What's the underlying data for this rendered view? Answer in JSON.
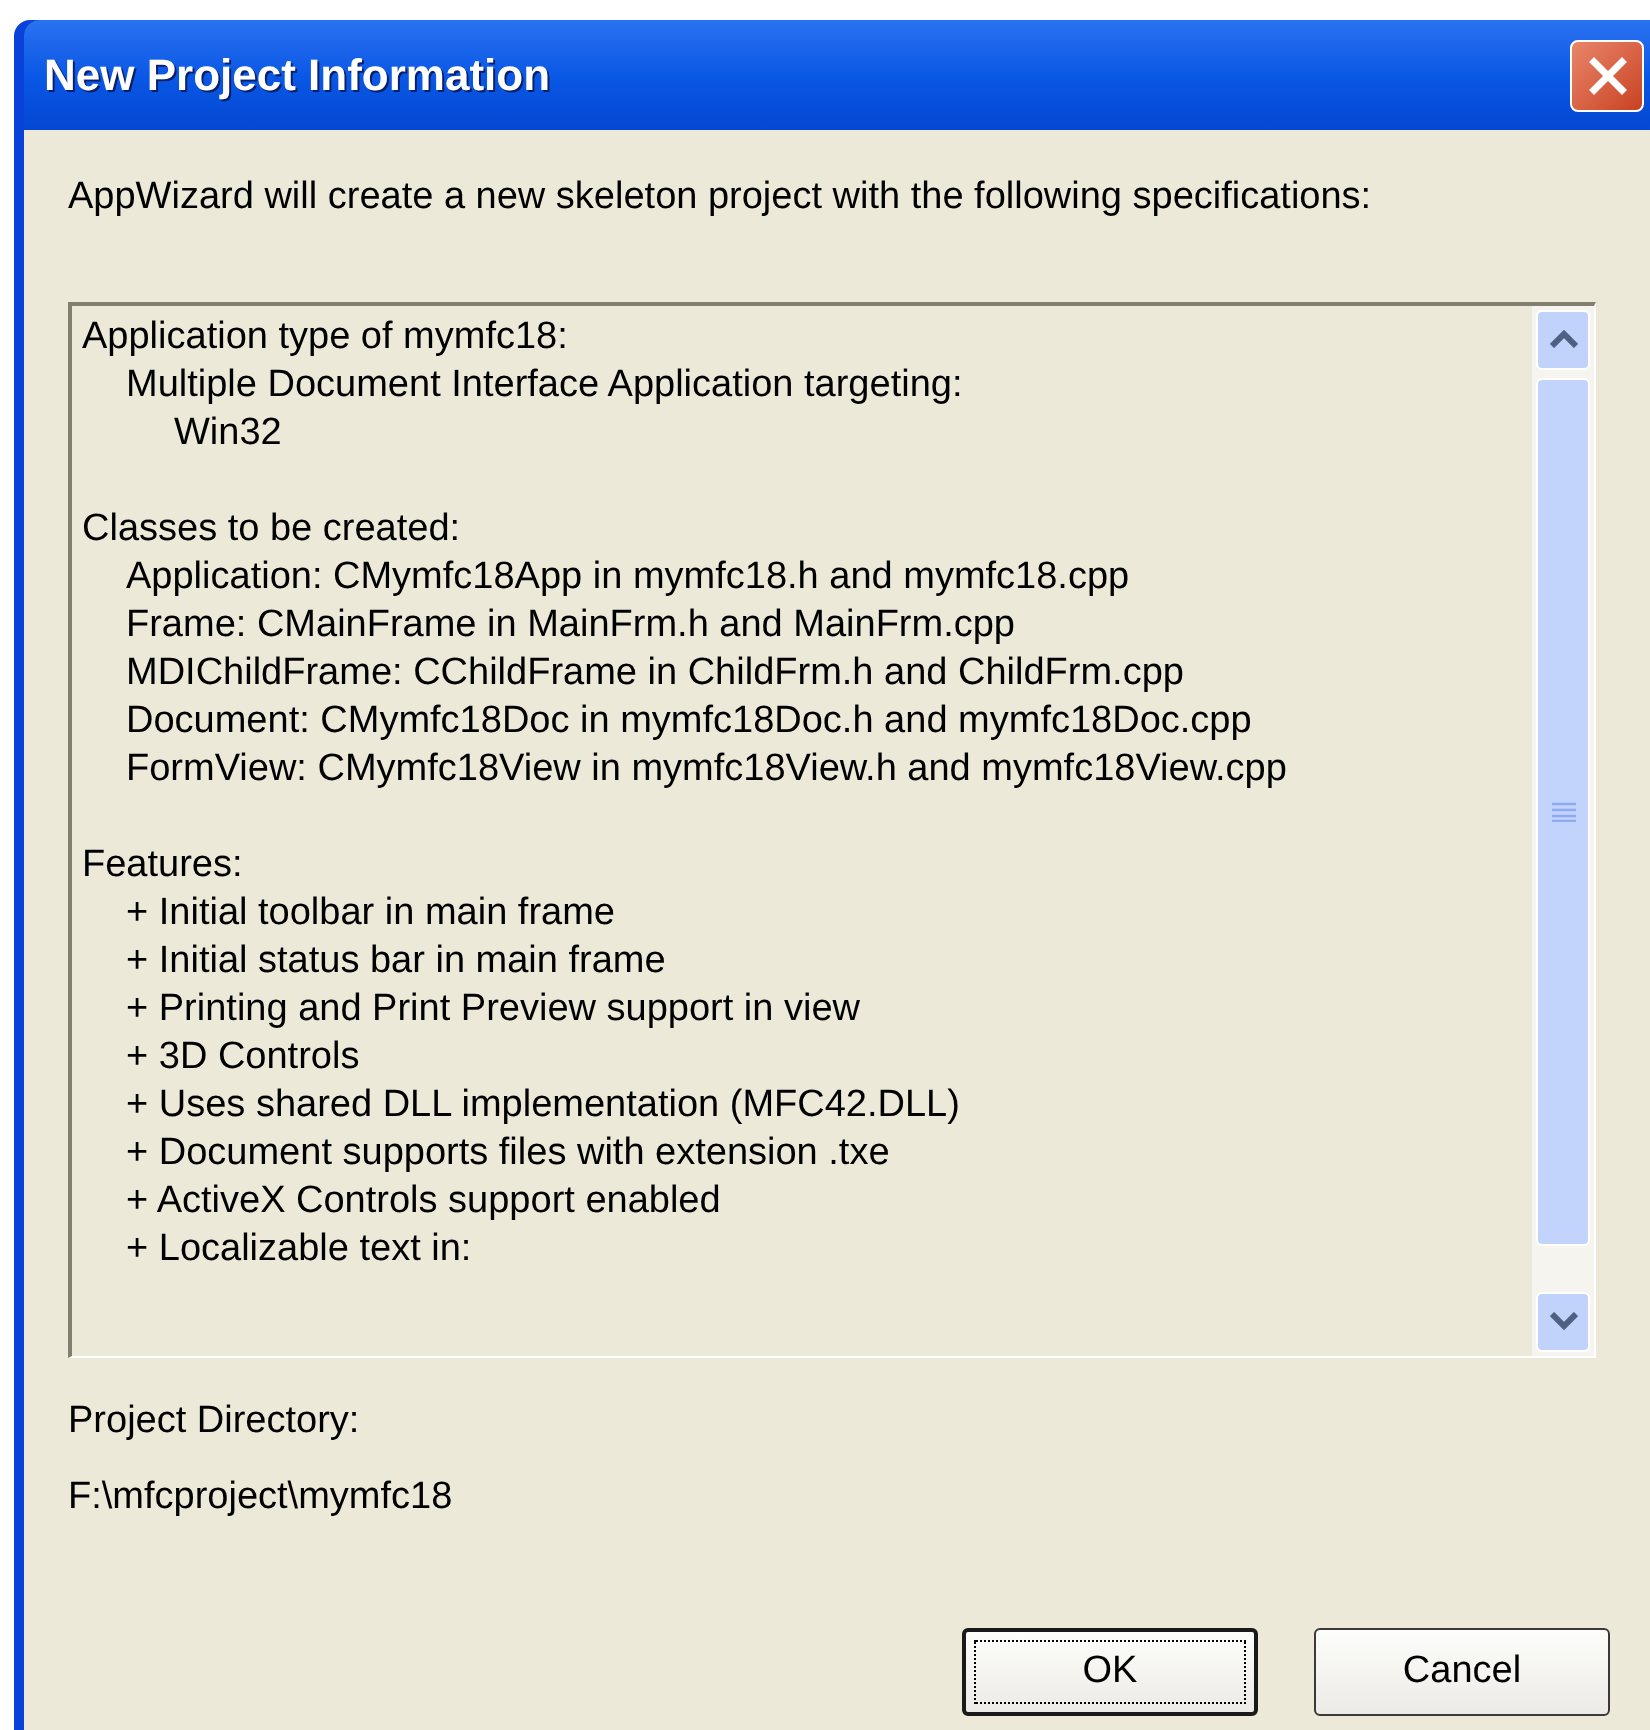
{
  "window": {
    "title": "New Project Information"
  },
  "intro": "AppWizard will create a new skeleton project with the following specifications:",
  "specifications": [
    {
      "text": "Application type of mymfc18:",
      "children": [
        {
          "text": "Multiple Document Interface Application targeting:",
          "children": [
            {
              "text": "Win32"
            }
          ]
        }
      ]
    },
    {
      "text": "Classes to be created:",
      "children": [
        {
          "text": "Application: CMymfc18App in mymfc18.h and mymfc18.cpp"
        },
        {
          "text": "Frame: CMainFrame in MainFrm.h and MainFrm.cpp"
        },
        {
          "text": "MDIChildFrame: CChildFrame in ChildFrm.h and ChildFrm.cpp"
        },
        {
          "text": "Document: CMymfc18Doc in mymfc18Doc.h and mymfc18Doc.cpp"
        },
        {
          "text": "FormView: CMymfc18View in mymfc18View.h and mymfc18View.cpp"
        }
      ]
    },
    {
      "text": "Features:",
      "children": [
        {
          "text": "+ Initial toolbar in main frame"
        },
        {
          "text": "+ Initial status bar in main frame"
        },
        {
          "text": "+ Printing and Print Preview support in view"
        },
        {
          "text": "+ 3D Controls"
        },
        {
          "text": "+ Uses shared DLL implementation (MFC42.DLL)"
        },
        {
          "text": "+ Document supports files with extension .txe"
        },
        {
          "text": "+ ActiveX Controls support enabled"
        },
        {
          "text": "+ Localizable text in:"
        }
      ]
    }
  ],
  "project_directory": {
    "label": "Project Directory:",
    "value": "F:\\mfcproject\\mymfc18"
  },
  "buttons": [
    {
      "label": "OK",
      "default": true
    },
    {
      "label": "Cancel",
      "default": false
    }
  ]
}
